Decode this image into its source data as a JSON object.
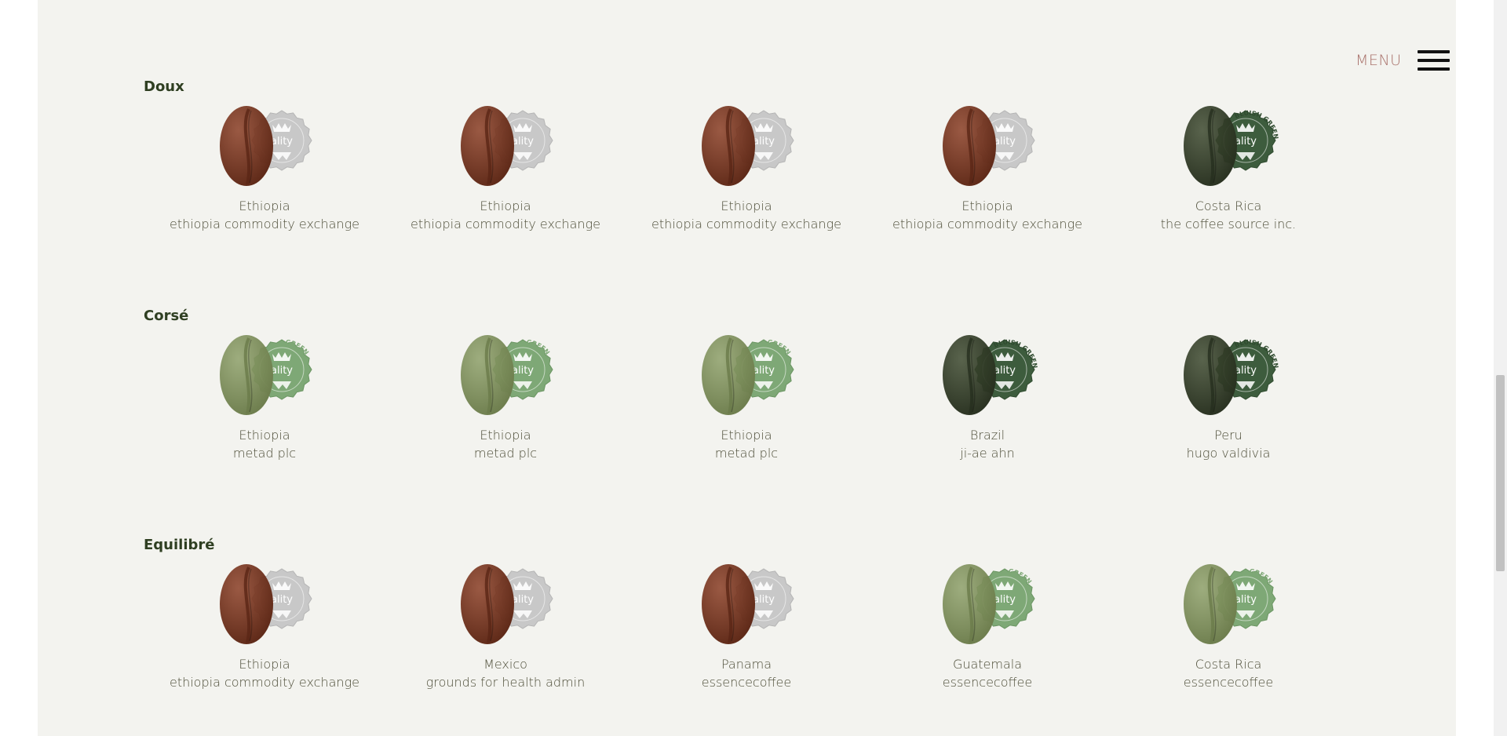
{
  "menu": {
    "label": "MENU"
  },
  "badge": {
    "text": "ality",
    "green_label": "GREEN",
    "bluish_label": "BLUISH GREEN"
  },
  "colors": {
    "roasted_bean": "#8a3e25",
    "green_bean": "#8ea06a",
    "dark_green_bean": "#3e4a30",
    "silver_badge": "#c8c8c8",
    "green_badge": "#7ea876",
    "dark_green_badge": "#3d5c3d",
    "page_bg": "#f3f3ef",
    "menu_text": "#a9726b"
  },
  "sections": [
    {
      "title": "Doux",
      "items": [
        {
          "origin": "Ethiopia",
          "vendor": "ethiopia commodity exchange",
          "style": "roasted"
        },
        {
          "origin": "Ethiopia",
          "vendor": "ethiopia commodity exchange",
          "style": "roasted"
        },
        {
          "origin": "Ethiopia",
          "vendor": "ethiopia commodity exchange",
          "style": "roasted"
        },
        {
          "origin": "Ethiopia",
          "vendor": "ethiopia commodity exchange",
          "style": "roasted"
        },
        {
          "origin": "Costa Rica",
          "vendor": "the coffee source inc.",
          "style": "bluish"
        }
      ]
    },
    {
      "title": "Corsé",
      "items": [
        {
          "origin": "Ethiopia",
          "vendor": "metad plc",
          "style": "green"
        },
        {
          "origin": "Ethiopia",
          "vendor": "metad plc",
          "style": "green"
        },
        {
          "origin": "Ethiopia",
          "vendor": "metad plc",
          "style": "green"
        },
        {
          "origin": "Brazil",
          "vendor": "ji-ae ahn",
          "style": "bluish"
        },
        {
          "origin": "Peru",
          "vendor": "hugo valdivia",
          "style": "bluish"
        }
      ]
    },
    {
      "title": "Equilibré",
      "items": [
        {
          "origin": "Ethiopia",
          "vendor": "ethiopia commodity exchange",
          "style": "roasted"
        },
        {
          "origin": "Mexico",
          "vendor": "grounds for health admin",
          "style": "roasted"
        },
        {
          "origin": "Panama",
          "vendor": "essencecoffee",
          "style": "roasted"
        },
        {
          "origin": "Guatemala",
          "vendor": "essencecoffee",
          "style": "green"
        },
        {
          "origin": "Costa Rica",
          "vendor": "essencecoffee",
          "style": "green"
        }
      ]
    }
  ]
}
